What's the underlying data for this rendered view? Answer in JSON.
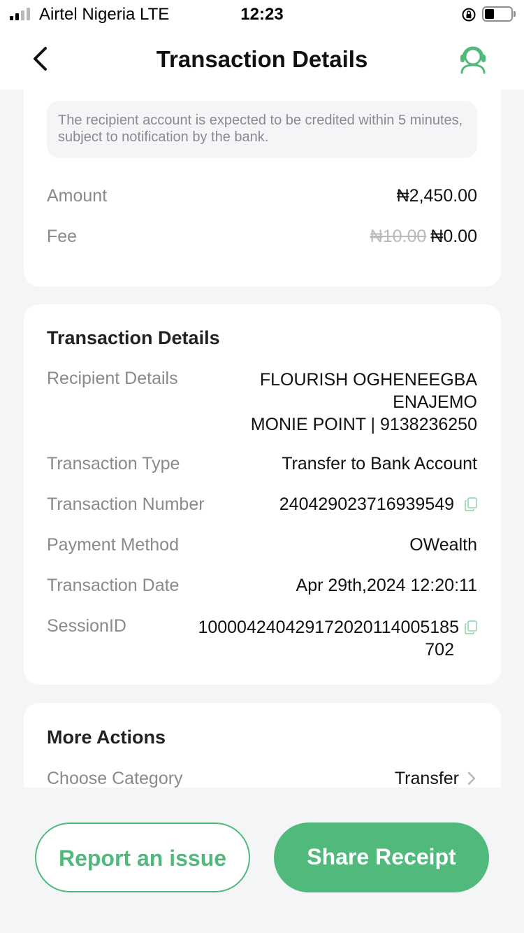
{
  "status_bar": {
    "carrier": "Airtel Nigeria  LTE",
    "time": "12:23"
  },
  "nav": {
    "title": "Transaction Details"
  },
  "summary": {
    "notice": "The recipient account is expected to be credited within 5 minutes, subject to notification by the bank.",
    "amount_label": "Amount",
    "amount_value": "₦2,450.00",
    "fee_label": "Fee",
    "fee_original": "₦10.00",
    "fee_value": "₦0.00"
  },
  "details": {
    "title": "Transaction Details",
    "recipient_label": "Recipient Details",
    "recipient_name_line1": "FLOURISH OGHENEEGBA",
    "recipient_name_line2": "ENAJEMO",
    "recipient_bank": "MONIE POINT | 9138236250",
    "type_label": "Transaction Type",
    "type_value": "Transfer to Bank Account",
    "number_label": "Transaction Number",
    "number_value": "240429023716939549",
    "method_label": "Payment Method",
    "method_value": "OWealth",
    "date_label": "Transaction Date",
    "date_value": "Apr 29th,2024 12:20:11",
    "session_label": "SessionID",
    "session_line1": "100004240429172020114005185",
    "session_line2": "702"
  },
  "more_actions": {
    "title": "More Actions",
    "category_label": "Choose Category",
    "category_value": "Transfer"
  },
  "buttons": {
    "report": "Report an issue",
    "share": "Share Receipt"
  },
  "colors": {
    "accent": "#52b97d",
    "background": "#f4f5f7",
    "muted_text": "#8a8a8e"
  },
  "icons": [
    "back-chevron-icon",
    "customer-support-icon",
    "copy-icon",
    "chevron-right-icon",
    "orientation-lock-icon",
    "battery-icon",
    "signal-icon"
  ]
}
